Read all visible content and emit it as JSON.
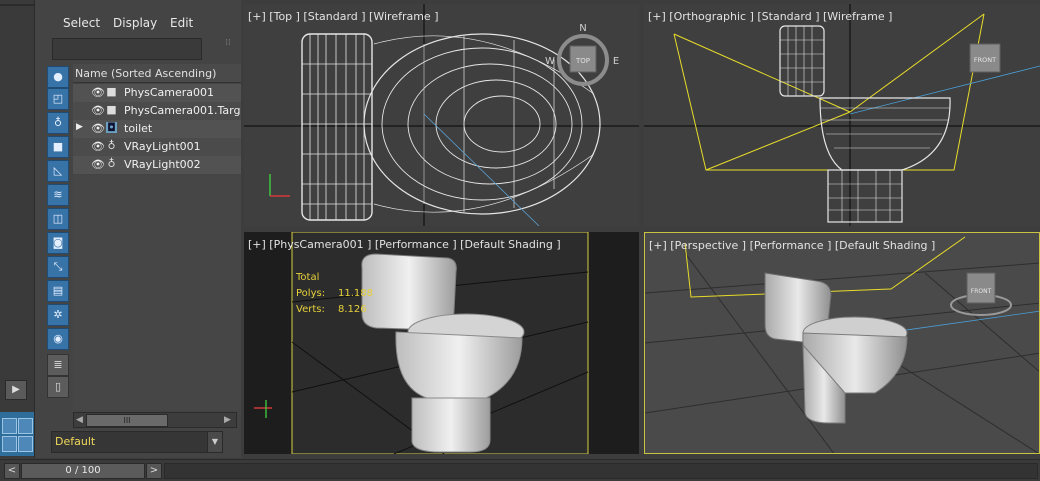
{
  "menu": {
    "select": "Select",
    "display": "Display",
    "edit": "Edit"
  },
  "explorer": {
    "column_header": "Name (Sorted Ascending)",
    "items": [
      {
        "label": "PhysCamera001",
        "icon": "camera-icon",
        "expanded": false
      },
      {
        "label": "PhysCamera001.Target",
        "icon": "camera-target-icon",
        "expanded": false
      },
      {
        "label": "toilet",
        "icon": "mesh-object-icon",
        "expanded": true
      },
      {
        "label": "VRayLight001",
        "icon": "light-bulb-icon",
        "expanded": false
      },
      {
        "label": "VRayLight002",
        "icon": "light-bulb-icon",
        "expanded": false
      }
    ],
    "layer_value": "Default",
    "scroll_thumb": "III"
  },
  "viewports": {
    "top": {
      "label": "[+] [Top ] [Standard ] [Wireframe ]"
    },
    "ortho": {
      "label": "[+] [Orthographic ] [Standard ] [Wireframe ]"
    },
    "camera": {
      "label": "[+] [PhysCamera001 ] [Performance ] [Default Shading ]"
    },
    "perspective": {
      "label": "[+] [Perspective ] [Performance ] [Default Shading ]"
    }
  },
  "viewcube": {
    "top_face": "TOP",
    "front_face": "FRONT",
    "compass": {
      "n": "N",
      "w": "W",
      "e": "E"
    }
  },
  "stats": {
    "header": "Total",
    "polys_label": "Polys:",
    "polys_value": "11.188",
    "verts_label": "Verts:",
    "verts_value": "8.126"
  },
  "time_slider": {
    "value": "0 / 100",
    "prev": "<",
    "next": ">"
  },
  "colors": {
    "accent": "#3873a8",
    "stats_yellow": "#e7d13a",
    "active_border": "#c8c340",
    "wire_white": "#e6e6e6"
  }
}
